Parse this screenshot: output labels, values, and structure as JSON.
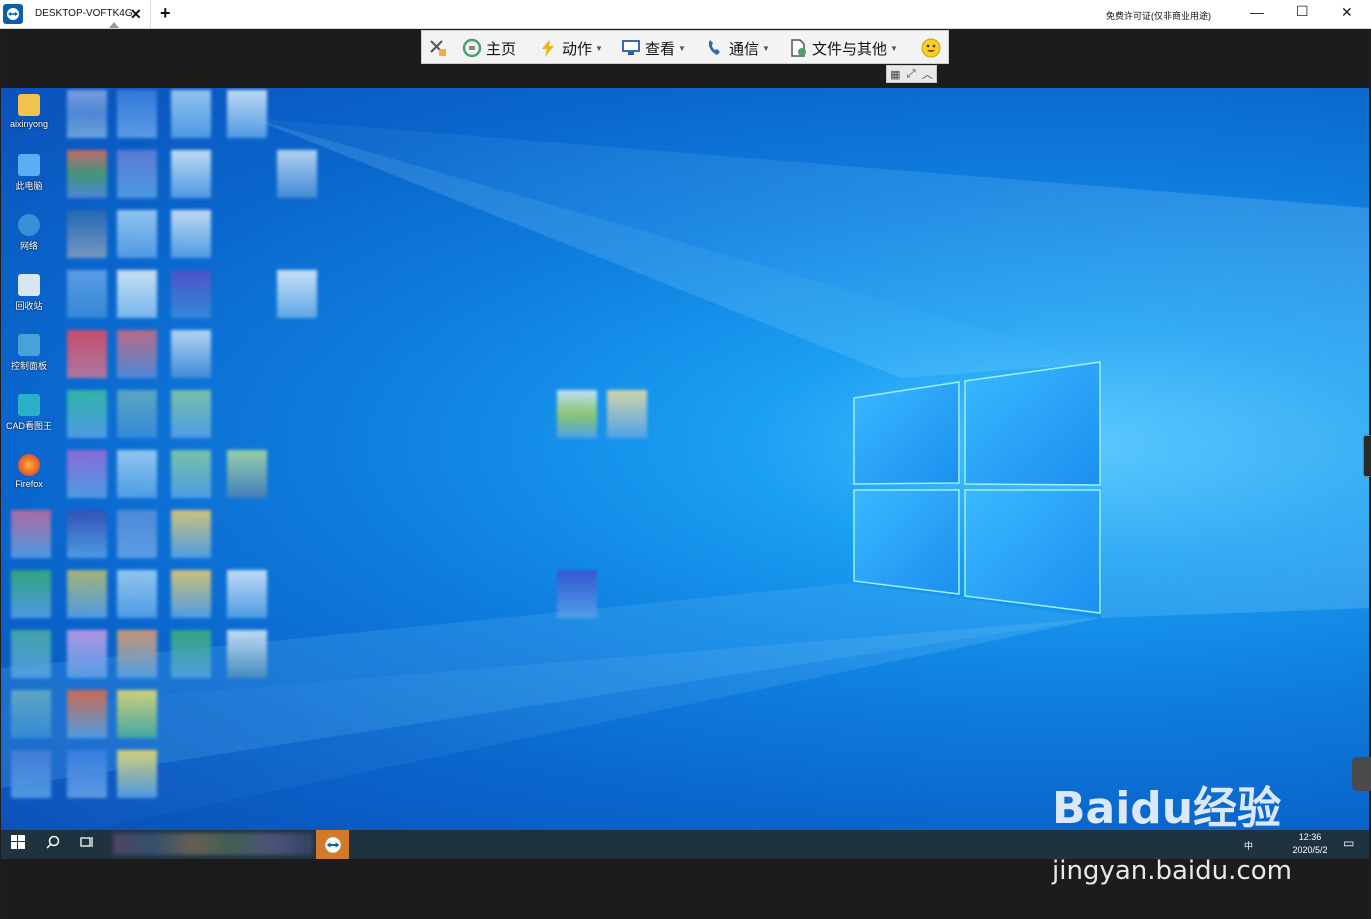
{
  "titlebar": {
    "tab_title": "DESKTOP-VOFTK4G",
    "tab_close": "✕",
    "add_tab": "+",
    "license_text": "免费许可证(仅非商业用途)",
    "minimize": "—",
    "maximize": "☐",
    "close": "✕"
  },
  "toolbar": {
    "items": [
      {
        "label": "",
        "icon": "disconnect-icon"
      },
      {
        "label": "主页",
        "icon": "home-icon"
      },
      {
        "label": "动作",
        "icon": "lightning-icon"
      },
      {
        "label": "查看",
        "icon": "monitor-icon"
      },
      {
        "label": "通信",
        "icon": "phone-icon"
      },
      {
        "label": "文件与其他",
        "icon": "file-icon"
      },
      {
        "label": "",
        "icon": "smiley-icon"
      }
    ],
    "dropdown_caret": "▼"
  },
  "desktop_icons": [
    {
      "label": "aixinyong",
      "icon": "user-folder-icon",
      "color": "#f2c14e"
    },
    {
      "label": "此电脑",
      "icon": "computer-icon",
      "color": "#5ab0f0"
    },
    {
      "label": "网络",
      "icon": "network-icon",
      "color": "#3a8fd9"
    },
    {
      "label": "回收站",
      "icon": "recycle-bin-icon",
      "color": "#d9e6f2"
    },
    {
      "label": "控制面板",
      "icon": "control-panel-icon",
      "color": "#4aa0d8"
    },
    {
      "label": "CAD看图王",
      "icon": "cad-icon",
      "color": "#2bb0c8"
    },
    {
      "label": "Firefox",
      "icon": "firefox-icon",
      "color": "#e8622a"
    }
  ],
  "taskbar": {
    "time": "12:36",
    "date": "2020/5/2",
    "ime": "中"
  },
  "watermark": {
    "logo": "Baidu经验",
    "url": "jingyan.baidu.com"
  },
  "colors": {
    "desktop_blue": "#1080e0",
    "taskbar": "#1f3240",
    "teamviewer_orange": "#d07a2a"
  }
}
